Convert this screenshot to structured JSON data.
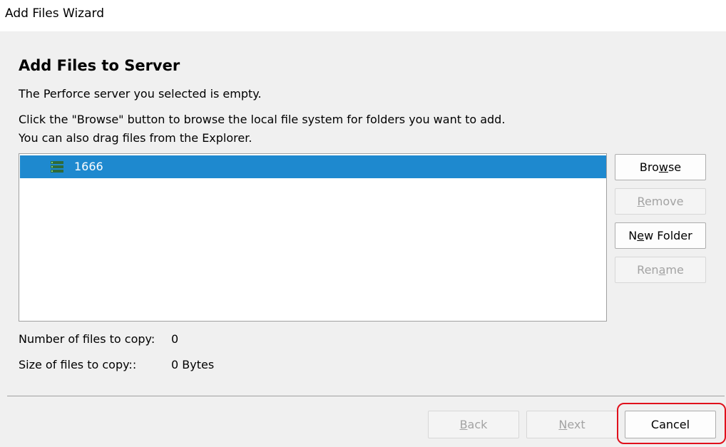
{
  "window": {
    "title": "Add Files Wizard"
  },
  "page": {
    "heading": "Add Files to Server",
    "description_1": "The Perforce server you selected is empty.",
    "description_2": "Click the \"Browse\" button to browse the local file system for folders you want to add.",
    "description_3": "You can also drag files from the Explorer."
  },
  "tree": {
    "items": [
      {
        "label": "1666",
        "icon": "server-icon",
        "selected": true
      }
    ],
    "selection_color": "#1e89cf"
  },
  "side_buttons": {
    "browse": {
      "pre": "Bro",
      "key": "w",
      "post": "se"
    },
    "remove": {
      "pre": "",
      "key": "R",
      "post": "emove"
    },
    "new_folder": {
      "pre": "N",
      "key": "e",
      "post": "w Folder"
    },
    "rename": {
      "pre": "Ren",
      "key": "a",
      "post": "me"
    }
  },
  "stats": {
    "files_label": "Number of files to copy:",
    "files_value": "0",
    "size_label": "Size of files to copy::",
    "size_value": "0 Bytes"
  },
  "footer": {
    "back": {
      "pre": "",
      "key": "B",
      "post": "ack"
    },
    "next": {
      "pre": "",
      "key": "N",
      "post": "ext"
    },
    "cancel_label": "Cancel"
  },
  "colors": {
    "highlight": "#e0101c",
    "disabled_text": "#a3a3a3"
  }
}
